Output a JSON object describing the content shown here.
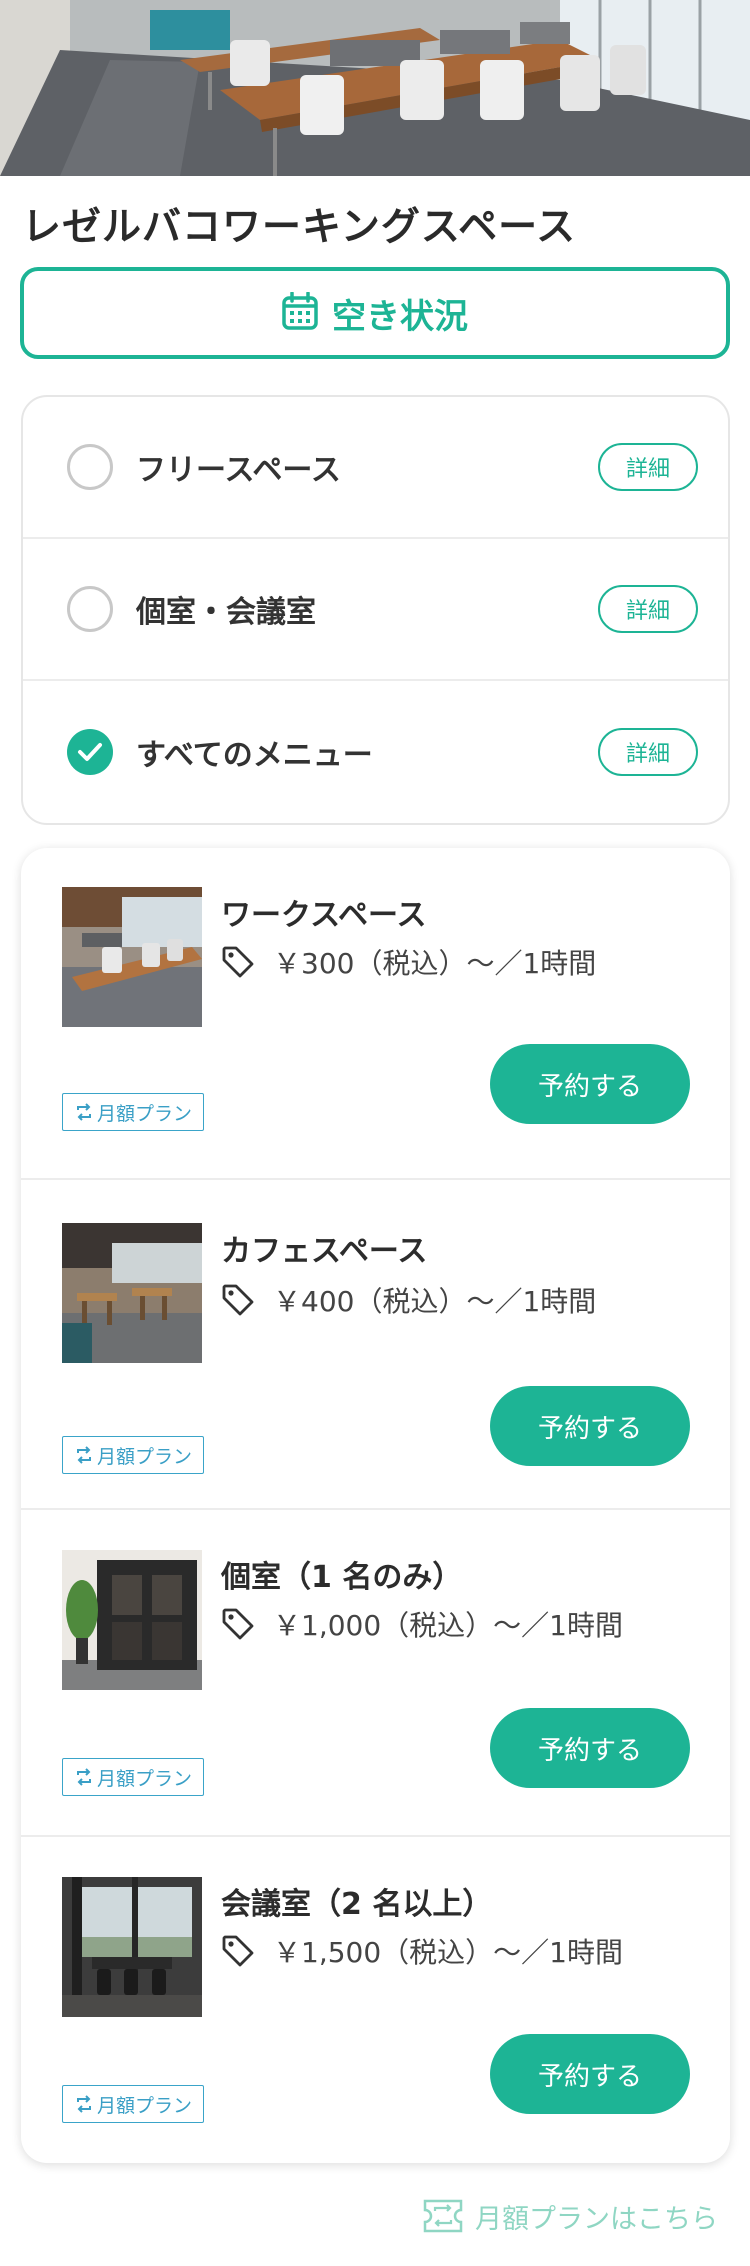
{
  "page": {
    "title": "レゼルバコワーキングスペース"
  },
  "availability_button": {
    "icon": "calendar-icon",
    "label": "空き状況"
  },
  "filters": [
    {
      "label": "フリースペース",
      "detail_label": "詳細",
      "checked": false
    },
    {
      "label": "個室・会議室",
      "detail_label": "詳細",
      "checked": false
    },
    {
      "label": "すべてのメニュー",
      "detail_label": "詳細",
      "checked": true
    }
  ],
  "plans": [
    {
      "name": "ワークスペース",
      "price": "￥300（税込）〜／1時間",
      "badge": "月額プラン",
      "reserve_label": "予約する",
      "thumb": "workspace-photo"
    },
    {
      "name": "カフェスペース",
      "price": "￥400（税込）〜／1時間",
      "badge": "月額プラン",
      "reserve_label": "予約する",
      "thumb": "cafe-photo"
    },
    {
      "name": "個室（1 名のみ）",
      "price": "￥1,000（税込）〜／1時間",
      "badge": "月額プラン",
      "reserve_label": "予約する",
      "thumb": "private-room-photo"
    },
    {
      "name": "会議室（2 名以上）",
      "price": "￥1,500（税込）〜／1時間",
      "badge": "月額プラン",
      "reserve_label": "予約する",
      "thumb": "meeting-room-photo"
    }
  ],
  "footer": {
    "monthly_link": "月額プランはこちら",
    "icon": "ticket-icon"
  },
  "colors": {
    "accent": "#1db495",
    "badge": "#3a9fc6",
    "footer_link": "#8fd6c3"
  }
}
